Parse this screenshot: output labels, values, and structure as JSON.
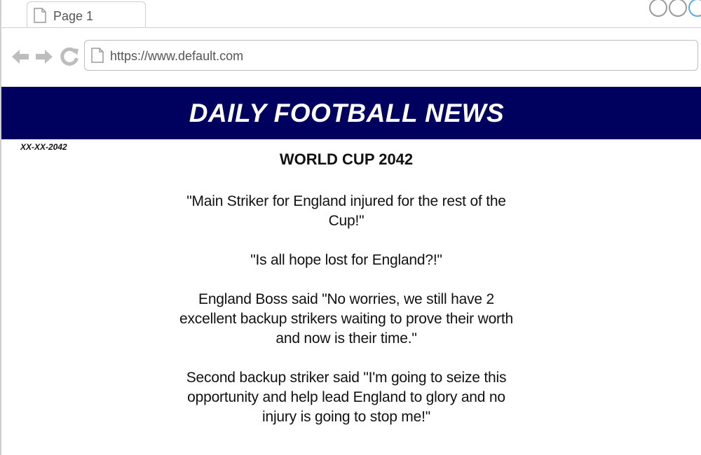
{
  "browser": {
    "tab_title": "Page 1",
    "url": "https://www.default.com",
    "icons": {
      "back": "arrow-left-icon",
      "forward": "arrow-right-icon",
      "reload": "reload-icon",
      "page": "page-icon"
    }
  },
  "site": {
    "banner_title": "DAILY FOOTBALL NEWS",
    "banner_color": "#00005f",
    "date": "XX-XX-2042"
  },
  "article": {
    "headline": "WORLD CUP 2042",
    "paragraphs": [
      "\"Main Striker for England injured for the rest of the Cup!\"",
      "\"Is all hope lost for England?!\"",
      "England Boss said \"No worries, we still have 2 excellent backup strikers waiting to prove their worth and now is their time.\"",
      "Second backup striker said \"I'm going to seize this opportunity and help lead England to glory and no injury is going to stop me!\""
    ]
  }
}
